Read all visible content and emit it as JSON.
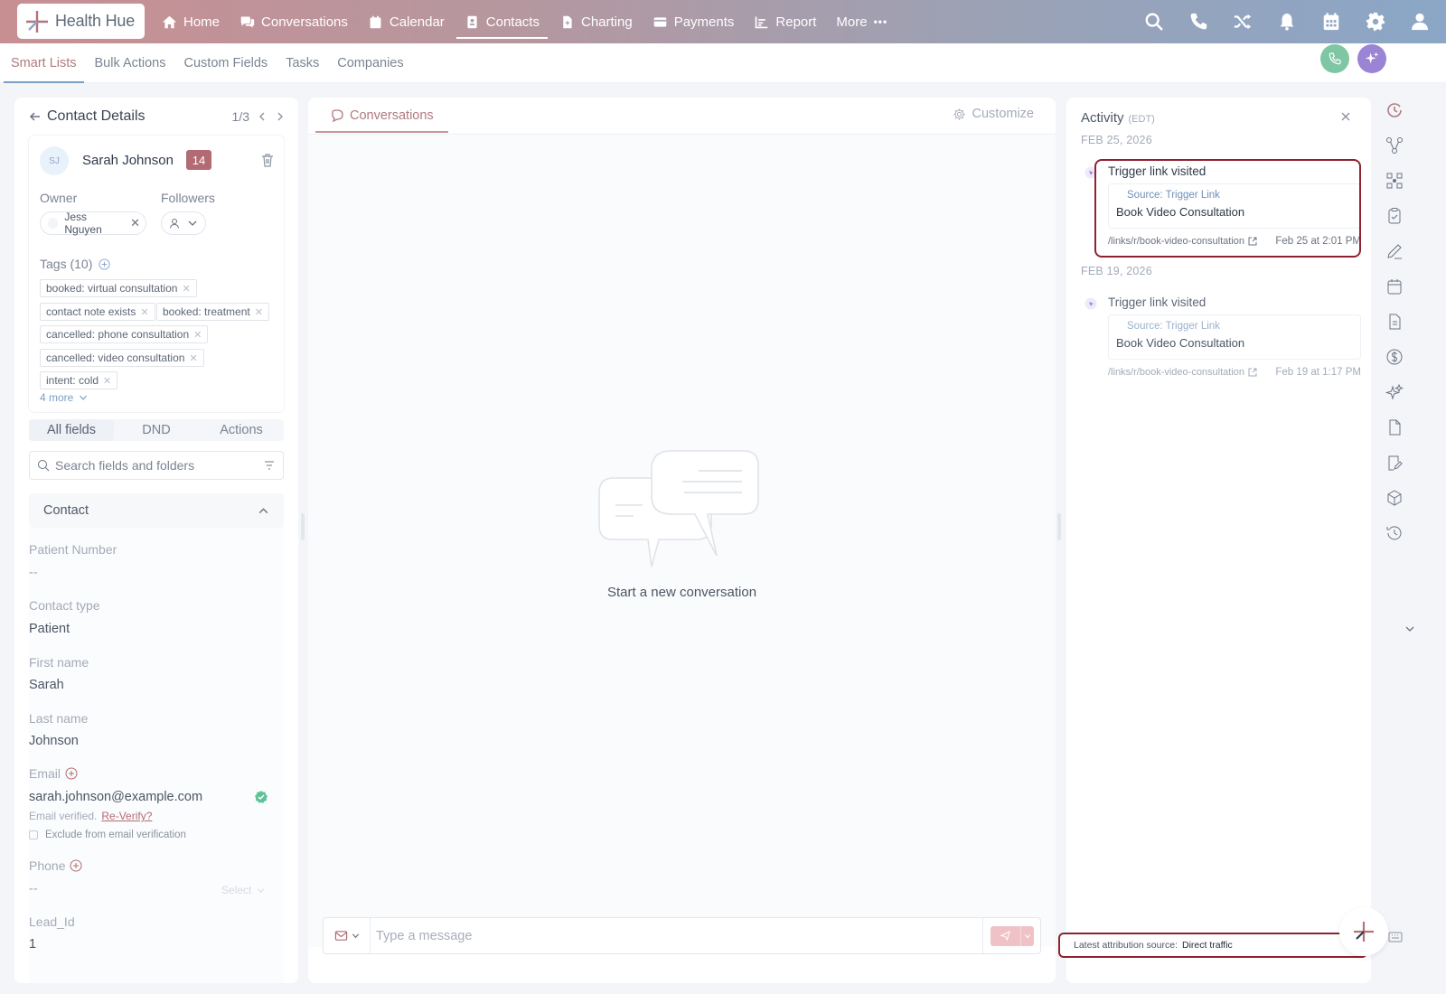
{
  "app": {
    "brand": "Health Hue",
    "colors": {
      "accent": "#b07a80",
      "badge": "#b26b72",
      "highlight": "#8f2230",
      "call": "#7fc7a4",
      "ai": "#9b83d6"
    }
  },
  "topnav": {
    "items": [
      {
        "label": "Home",
        "icon": "home-icon"
      },
      {
        "label": "Conversations",
        "icon": "chat-bubbles-icon"
      },
      {
        "label": "Calendar",
        "icon": "calendar-icon"
      },
      {
        "label": "Contacts",
        "icon": "contact-card-icon",
        "active": true
      },
      {
        "label": "Charting",
        "icon": "document-icon"
      },
      {
        "label": "Payments",
        "icon": "credit-card-icon"
      },
      {
        "label": "Report",
        "icon": "bar-chart-icon"
      },
      {
        "label": "More",
        "icon": "ellipsis-icon"
      }
    ],
    "right_icons": [
      "search-icon",
      "phone-icon",
      "shuffle-icon",
      "bell-icon",
      "calendar-grid-icon",
      "gear-icon",
      "user-icon"
    ]
  },
  "subnav": {
    "tabs": [
      "Smart Lists",
      "Bulk Actions",
      "Custom Fields",
      "Tasks",
      "Companies"
    ],
    "active": "Smart Lists"
  },
  "contact_details": {
    "title": "Contact Details",
    "pager": "1/3",
    "contact": {
      "initials": "SJ",
      "name": "Sarah Johnson",
      "badge": "14"
    },
    "owner_label": "Owner",
    "owner": "Jess Nguyen",
    "followers_label": "Followers",
    "tags_label": "Tags (10)",
    "tags": [
      "booked: virtual consultation",
      "contact note exists",
      "booked: treatment",
      "cancelled: phone consultation",
      "cancelled: video consultation",
      "intent: cold"
    ],
    "more_tags": "4 more",
    "tabs": [
      "All fields",
      "DND",
      "Actions"
    ],
    "active_tab": "All fields",
    "search_placeholder": "Search fields and folders",
    "section": "Contact",
    "fields": {
      "patient_number": {
        "label": "Patient Number",
        "value": "--"
      },
      "contact_type": {
        "label": "Contact type",
        "value": "Patient"
      },
      "first_name": {
        "label": "First name",
        "value": "Sarah"
      },
      "last_name": {
        "label": "Last name",
        "value": "Johnson"
      },
      "email": {
        "label": "Email",
        "value": "sarah.johnson@example.com",
        "verified_text": "Email verified.",
        "reverify": "Re-Verify?",
        "exclude": "Exclude from email verification"
      },
      "phone": {
        "label": "Phone",
        "value": "--",
        "select": "Select"
      },
      "lead_id": {
        "label": "Lead_Id",
        "value": "1"
      }
    }
  },
  "conversations": {
    "tab": "Conversations",
    "customize": "Customize",
    "empty": "Start a new conversation",
    "message_placeholder": "Type a message"
  },
  "activity": {
    "title": "Activity",
    "timezone": "(EDT)",
    "groups": [
      {
        "date": "FEB 25, 2026",
        "title": "Trigger link visited",
        "source": "Source: Trigger Link",
        "name": "Book Video Consultation",
        "path": "/links/r/book-video-consultation",
        "time": "Feb 25 at 2:01 PM"
      },
      {
        "date": "FEB 19, 2026",
        "title": "Trigger link visited",
        "source": "Source: Trigger Link",
        "name": "Book Video Consultation",
        "path": "/links/r/book-video-consultation",
        "time": "Feb 19 at 1:17 PM"
      }
    ],
    "attribution_label": "Latest attribution source:",
    "attribution_value": "Direct traffic"
  },
  "right_rail": [
    "clock-icon",
    "workflow-icon",
    "automation-icon",
    "clipboard-check-icon",
    "pen-icon",
    "calendar-icon",
    "document-icon",
    "dollar-icon",
    "sparkle-icon",
    "file-icon",
    "edit-document-icon",
    "box-icon",
    "history-icon"
  ]
}
